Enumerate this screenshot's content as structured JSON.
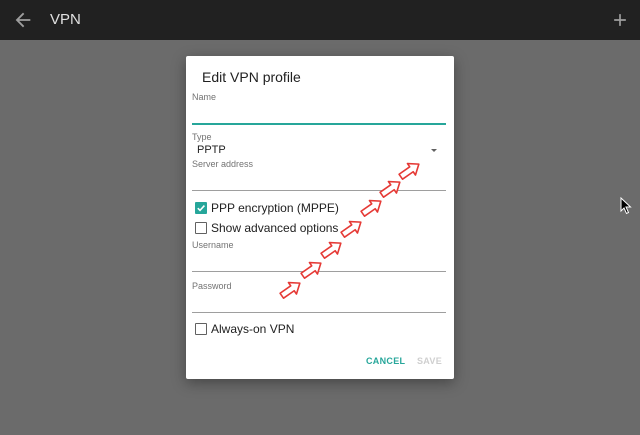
{
  "app_bar": {
    "title": "VPN",
    "back_icon": "arrow-left-icon",
    "add_icon": "plus-icon"
  },
  "dialog": {
    "title": "Edit VPN profile",
    "name": {
      "label": "Name",
      "value": ""
    },
    "type": {
      "label": "Type",
      "value": "PPTP"
    },
    "server": {
      "label": "Server address",
      "value": ""
    },
    "ppp_encryption": {
      "label": "PPP encryption (MPPE)",
      "checked": true
    },
    "advanced": {
      "label": "Show advanced options",
      "checked": false
    },
    "username": {
      "label": "Username",
      "value": ""
    },
    "password": {
      "label": "Password",
      "value": ""
    },
    "always_on": {
      "label": "Always-on VPN",
      "checked": false
    },
    "buttons": {
      "cancel": "CANCEL",
      "save": "SAVE"
    }
  },
  "colors": {
    "app_bar": "#212121",
    "backdrop": "#6b6b6b",
    "accent": "#26a69a",
    "annotation_arrow": "#e53935"
  }
}
